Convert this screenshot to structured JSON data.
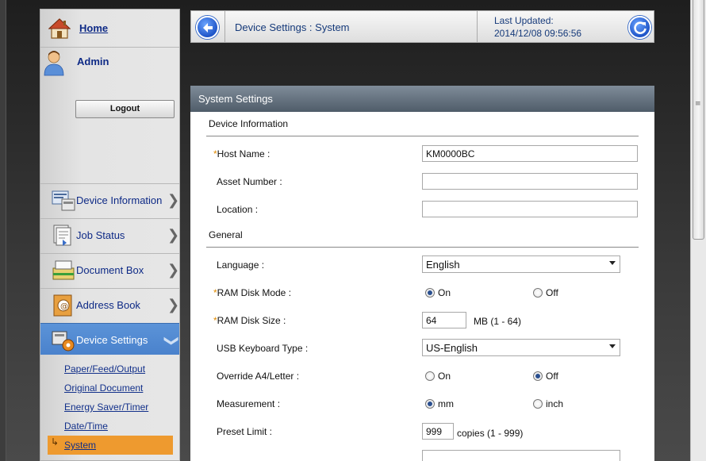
{
  "header": {
    "breadcrumb": "Device Settings : System",
    "last_updated_label": "Last Updated:",
    "last_updated_value": "2014/12/08 09:56:56"
  },
  "sidebar": {
    "home_label": "Home",
    "user_label": "Admin",
    "logout_label": "Logout",
    "menu": [
      {
        "label": "Device Information",
        "icon": "device-info-icon"
      },
      {
        "label": "Job Status",
        "icon": "job-status-icon"
      },
      {
        "label": "Document Box",
        "icon": "document-box-icon"
      },
      {
        "label": "Address Book",
        "icon": "address-book-icon"
      },
      {
        "label": "Device Settings",
        "icon": "device-settings-icon",
        "expanded": true
      }
    ],
    "submenu": [
      "Paper/Feed/Output",
      "Original Document",
      "Energy Saver/Timer",
      "Date/Time",
      "System"
    ],
    "active_submenu": "System"
  },
  "panel": {
    "title": "System Settings",
    "sections": {
      "device_information": "Device Information",
      "general": "General"
    },
    "fields": {
      "host_name": {
        "label": "Host Name :",
        "value": "KM0000BC",
        "required": true
      },
      "asset_number": {
        "label": "Asset Number :",
        "value": ""
      },
      "location": {
        "label": "Location :",
        "value": ""
      },
      "language": {
        "label": "Language :",
        "value": "English"
      },
      "ram_disk_mode": {
        "label": "RAM Disk Mode :",
        "options": [
          "On",
          "Off"
        ],
        "selected": "On",
        "required": true
      },
      "ram_disk_size": {
        "label": "RAM Disk Size :",
        "value": "64",
        "unit": "MB (1 - 64)",
        "required": true
      },
      "usb_keyboard_type": {
        "label": "USB Keyboard Type :",
        "value": "US-English"
      },
      "override_a4_letter": {
        "label": "Override A4/Letter :",
        "options": [
          "On",
          "Off"
        ],
        "selected": "Off"
      },
      "measurement": {
        "label": "Measurement :",
        "options": [
          "mm",
          "inch"
        ],
        "selected": "mm"
      },
      "preset_limit": {
        "label": "Preset Limit :",
        "value": "999",
        "unit": "copies (1 - 999)"
      }
    },
    "required_mark": "*"
  },
  "colors": {
    "active_menu": "#4a82cc",
    "active_submenu": "#ee9a2f",
    "panel_header": "#5f6c79",
    "link": "#0e2a86"
  }
}
